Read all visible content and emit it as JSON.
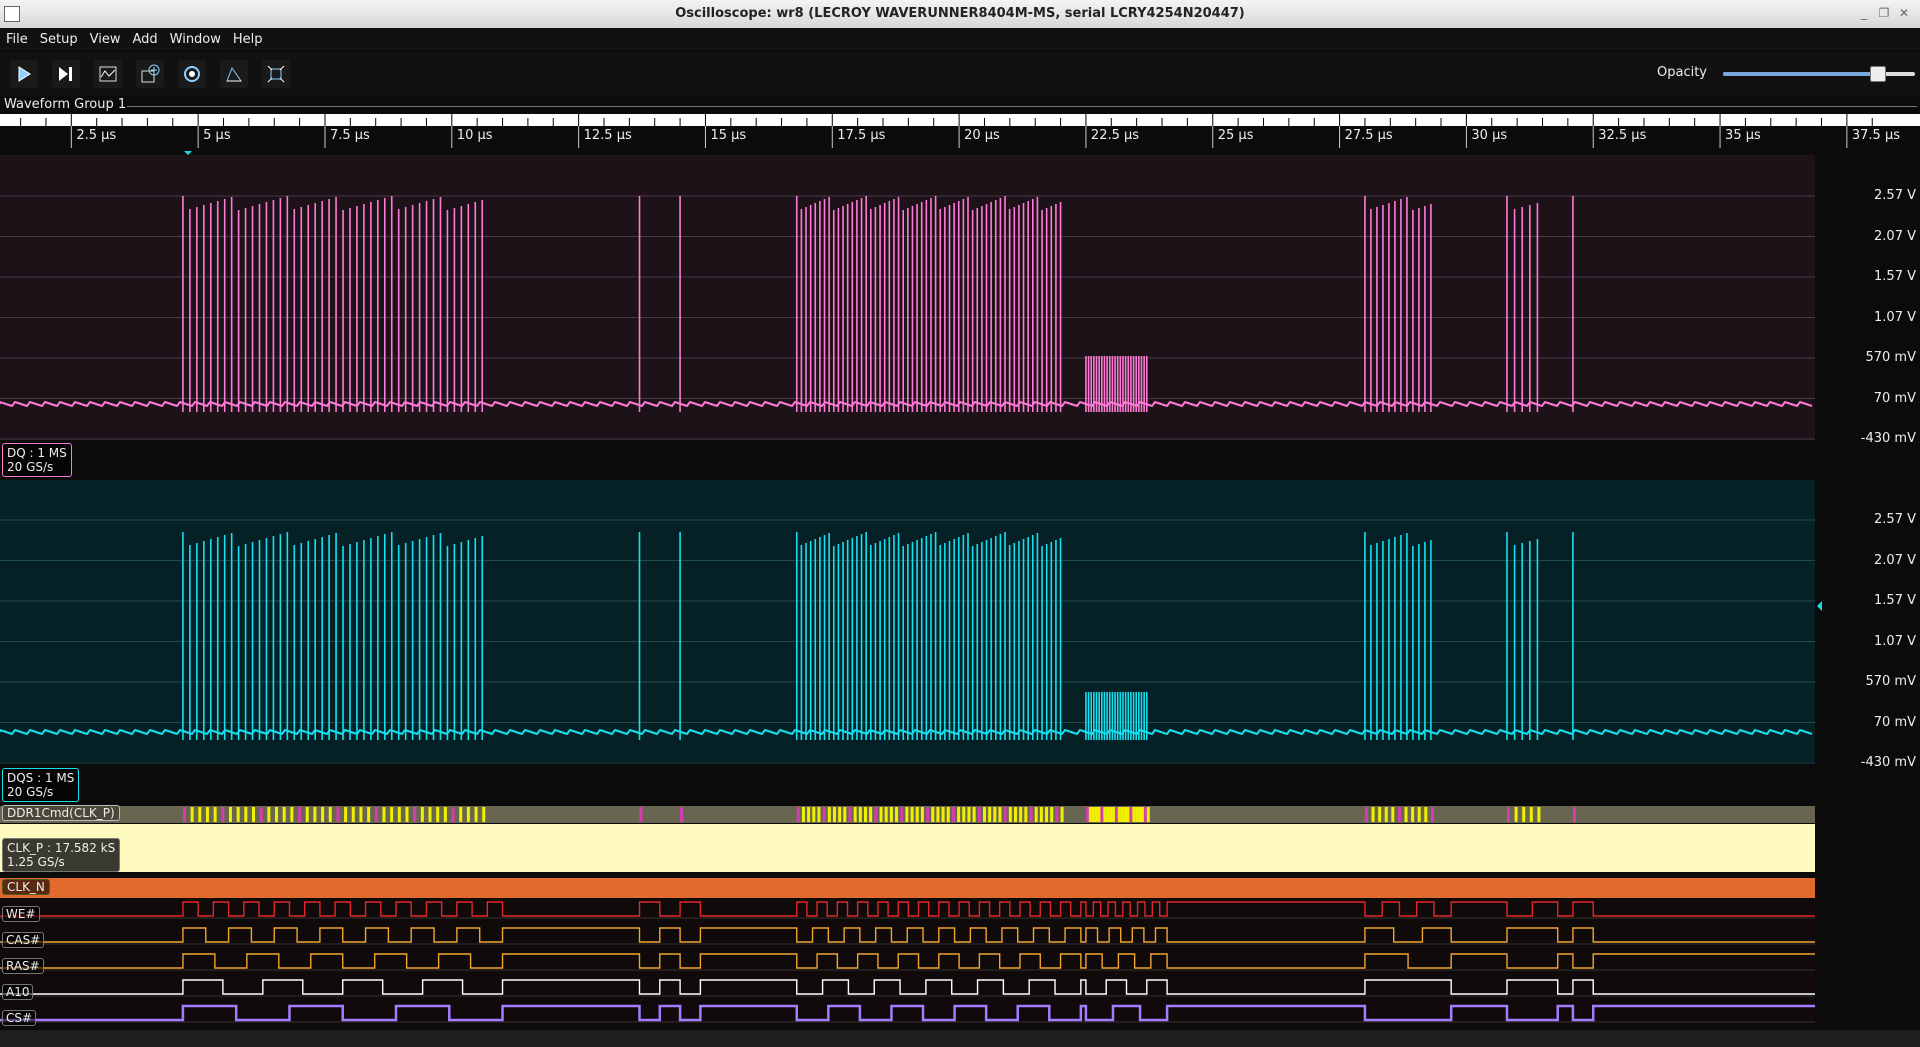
{
  "window": {
    "title": "Oscilloscope: wr8 (LECROY WAVERUNNER8404M-MS, serial LCRY4254N20447)"
  },
  "menu": [
    "File",
    "Setup",
    "View",
    "Add",
    "Window",
    "Help"
  ],
  "toolbar": {
    "icons": [
      "play-icon",
      "single-step-icon",
      "waveform-image-icon",
      "acquisition-add-icon",
      "trigger-icon",
      "measure-icon",
      "zoom-fit-icon"
    ],
    "opacity_label": "Opacity",
    "opacity_value": 0.8
  },
  "group": {
    "label": "Waveform Group 1"
  },
  "time_axis": {
    "ticks": [
      "2.5 µs",
      "5 µs",
      "7.5 µs",
      "10 µs",
      "12.5 µs",
      "15 µs",
      "17.5 µs",
      "20 µs",
      "22.5 µs",
      "25 µs",
      "27.5 µs",
      "30 µs",
      "32.5 µs",
      "35 µs",
      "37.5 µs"
    ]
  },
  "volt_ticks": [
    "2.57 V",
    "2.07 V",
    "1.57 V",
    "1.07 V",
    "570 mV",
    "70 mV",
    "-430 mV"
  ],
  "channels": {
    "dq": {
      "name": "DQ : 1 MS",
      "rate": "20 GS/s",
      "color": "#ff7ad8"
    },
    "dqs": {
      "name": "DQS : 1 MS",
      "rate": "20 GS/s",
      "color": "#16e0f0"
    },
    "ddr": {
      "name": "DDR1Cmd(CLK_P)"
    },
    "clkp": {
      "name": "CLK_P : 17.582 kS",
      "rate": "1.25 GS/s"
    },
    "clkn": {
      "name": "CLK_N"
    },
    "we": {
      "name": "WE#",
      "color": "#e2262a"
    },
    "cas": {
      "name": "CAS#",
      "color": "#f0a530"
    },
    "ras": {
      "name": "RAS#",
      "color": "#f0a530"
    },
    "a10": {
      "name": "A10",
      "color": "#ffffff"
    },
    "cs": {
      "name": "CS#",
      "color": "#a47cff"
    }
  }
}
